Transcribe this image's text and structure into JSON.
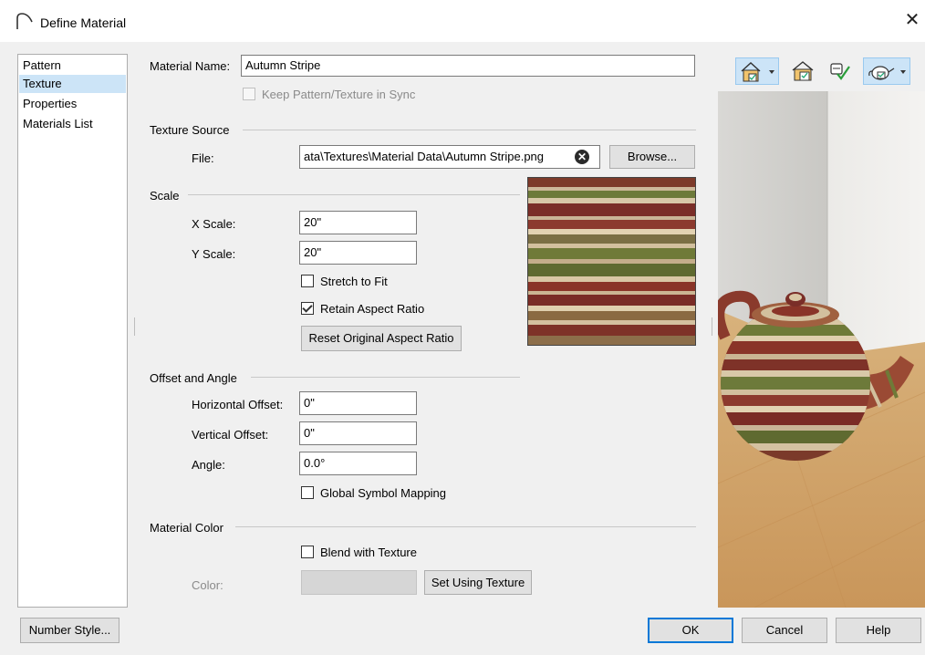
{
  "window": {
    "title": "Define Material",
    "close_glyph": "✕"
  },
  "nav": {
    "items": [
      {
        "label": "Pattern",
        "selected": false
      },
      {
        "label": "Texture",
        "selected": true
      },
      {
        "label": "Properties",
        "selected": false
      },
      {
        "label": "Materials List",
        "selected": false
      }
    ]
  },
  "material_name": {
    "label": "Material Name:",
    "value": "Autumn Stripe"
  },
  "keep_sync": {
    "label": "Keep Pattern/Texture in Sync",
    "checked": false,
    "enabled": false
  },
  "texture_source": {
    "heading": "Texture Source",
    "file_label": "File:",
    "file_value": "ata\\Textures\\Material Data\\Autumn Stripe.png",
    "clear_glyph": "✕",
    "browse_label": "Browse..."
  },
  "scale": {
    "heading": "Scale",
    "x_label": "X Scale:",
    "x_value": "20\"",
    "y_label": "Y Scale:",
    "y_value": "20\"",
    "stretch_label": "Stretch to Fit",
    "stretch_checked": false,
    "retain_label": "Retain Aspect Ratio",
    "retain_checked": true,
    "reset_label": "Reset Original Aspect Ratio"
  },
  "offset": {
    "heading": "Offset and Angle",
    "h_label": "Horizontal Offset:",
    "h_value": "0\"",
    "v_label": "Vertical Offset:",
    "v_value": "0\"",
    "angle_label": "Angle:",
    "angle_value": "0.0°",
    "global_label": "Global Symbol Mapping",
    "global_checked": false
  },
  "color": {
    "heading": "Material Color",
    "blend_label": "Blend with Texture",
    "blend_checked": false,
    "color_label": "Color:",
    "swatch": "#d6d6d6",
    "set_label": "Set Using Texture"
  },
  "footer": {
    "number_style_label": "Number Style...",
    "ok_label": "OK",
    "cancel_label": "Cancel",
    "help_label": "Help"
  },
  "preview_toolbar": {
    "icons": [
      "house-view-icon",
      "dropdown-arrow-icon",
      "room-view-icon",
      "check-material-icon",
      "teapot-view-icon",
      "dropdown-arrow-icon"
    ]
  },
  "colors": {
    "accent": "#0078d7",
    "selection": "#cce4f7",
    "dialog_bg": "#f0f0f0"
  }
}
